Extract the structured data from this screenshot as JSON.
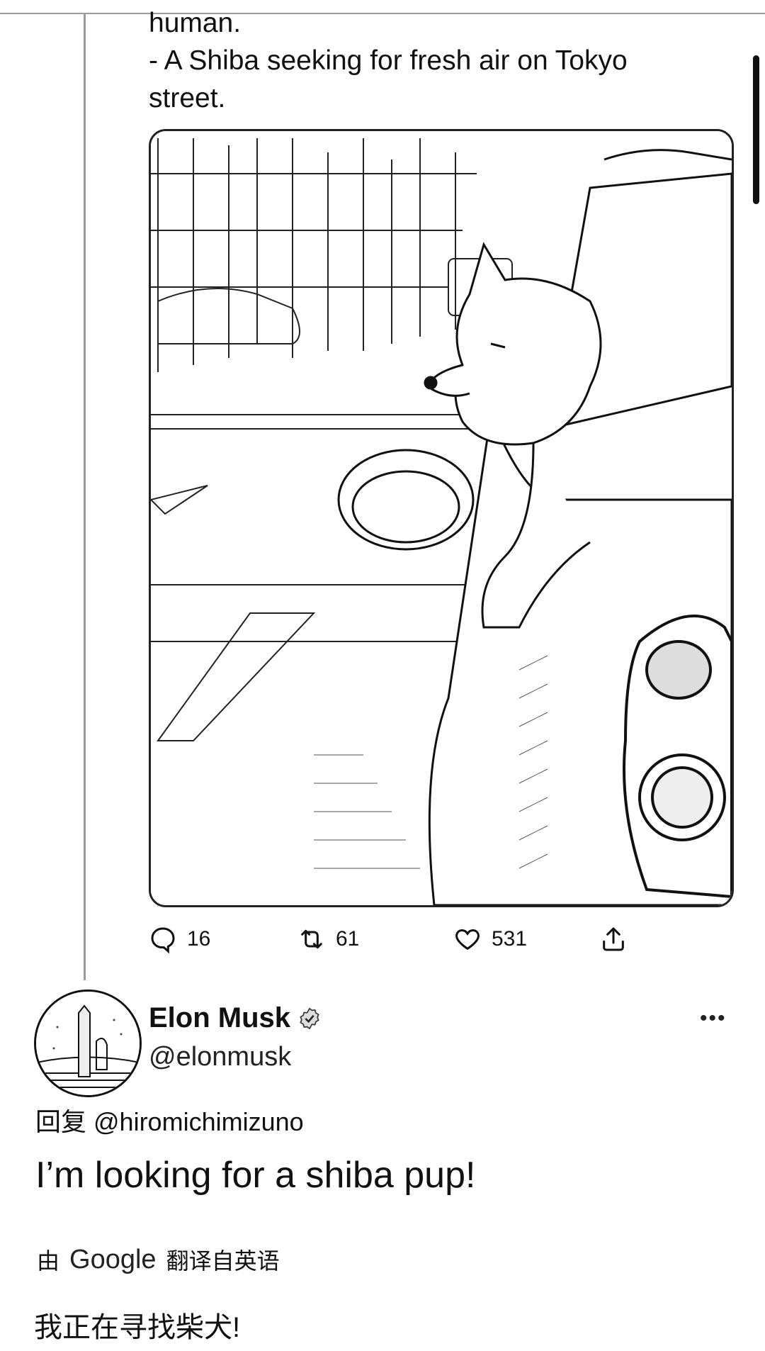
{
  "tweet": {
    "text": "human.\n- A Shiba seeking for fresh air on Tokyo street.",
    "stats": {
      "replies": "16",
      "retweets": "61",
      "likes": "531"
    }
  },
  "reply": {
    "name": "Elon Musk",
    "handle": "@elonmusk",
    "more": "•••",
    "reply_to": "回复 @hiromichimizuno",
    "text": "I’m looking for a shiba pup!",
    "translated_by_prefix": "由",
    "translated_by_brand": "Google",
    "translated_by_suffix": "翻译自英语",
    "translated_text": "我正在寻找柴犬!"
  },
  "icons": {
    "reply": "reply-icon",
    "retweet": "retweet-icon",
    "like": "heart-icon",
    "share": "share-icon",
    "verified": "verified-badge-icon",
    "more": "more-icon"
  },
  "colors": {
    "text": "#111111",
    "line": "#9a9a9a",
    "background": "#ffffff"
  }
}
